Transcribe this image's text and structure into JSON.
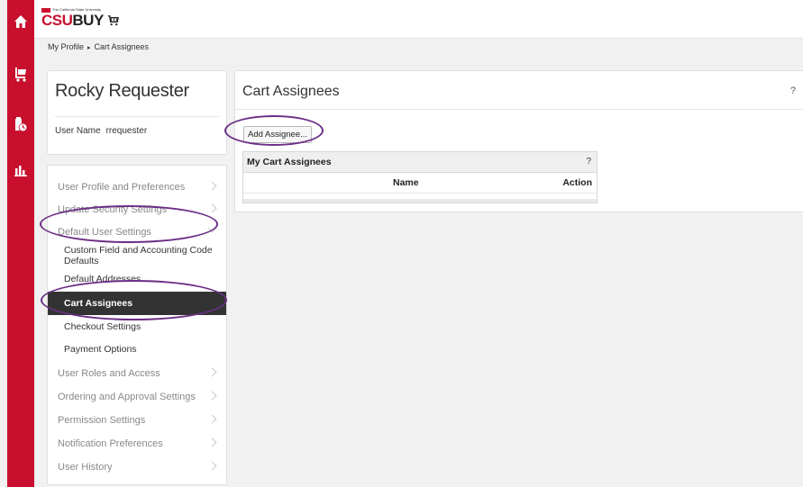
{
  "rail": {
    "icons": [
      "home-icon",
      "cart-icon",
      "order-history-icon",
      "reports-icon"
    ]
  },
  "header": {
    "logo_tagline": "The California State University",
    "logo_csu": "CSU",
    "logo_buy": "BUY"
  },
  "breadcrumb": {
    "parent": "My Profile",
    "separator": "▸",
    "current": "Cart Assignees"
  },
  "profile": {
    "name": "Rocky Requester",
    "username_label": "User Name",
    "username_value": "rrequester"
  },
  "nav": {
    "items": [
      {
        "label": "User Profile and Preferences"
      },
      {
        "label": "Update Security Settings"
      },
      {
        "label": "Default User Settings"
      }
    ],
    "subitems": [
      {
        "label": "Custom Field and Accounting Code Defaults"
      },
      {
        "label": "Default Addresses"
      },
      {
        "label": "Cart Assignees",
        "active": true
      },
      {
        "label": "Checkout Settings"
      },
      {
        "label": "Payment Options"
      }
    ],
    "items_after": [
      {
        "label": "User Roles and Access"
      },
      {
        "label": "Ordering and Approval Settings"
      },
      {
        "label": "Permission Settings"
      },
      {
        "label": "Notification Preferences"
      },
      {
        "label": "User History"
      }
    ]
  },
  "main": {
    "title": "Cart Assignees",
    "help": "?",
    "add_button": "Add Assignee...",
    "grid": {
      "title": "My Cart Assignees",
      "help": "?",
      "columns": [
        "Name",
        "Action"
      ]
    }
  },
  "annotation_color": "#6b2f86",
  "accent_color": "#c8102e"
}
